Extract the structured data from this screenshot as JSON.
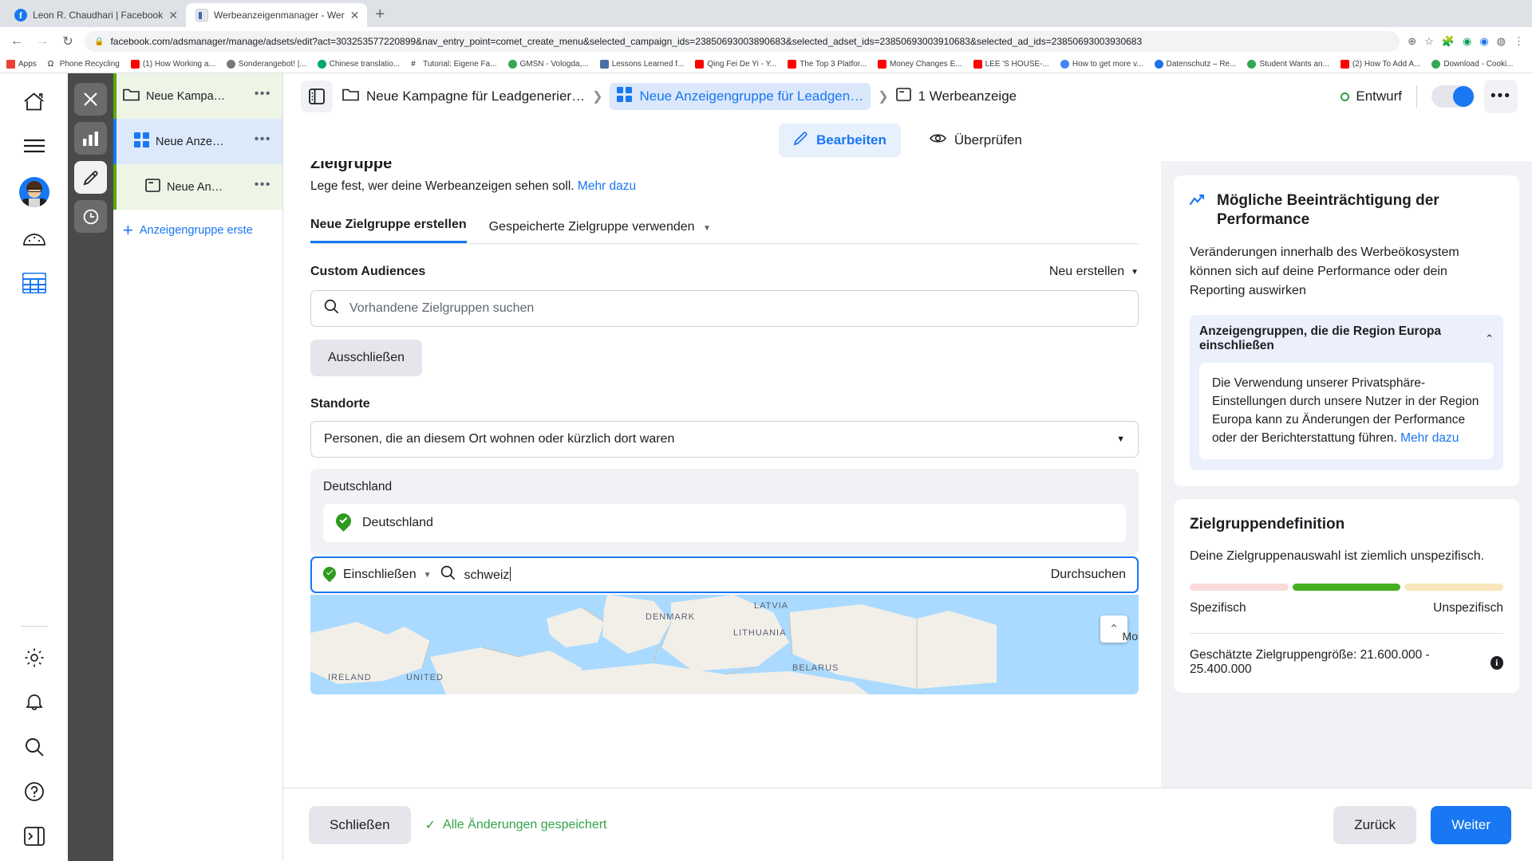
{
  "browser": {
    "tabs": [
      {
        "title": "Leon R. Chaudhari | Facebook",
        "favicon": "facebook-icon",
        "active": false
      },
      {
        "title": "Werbeanzeigenmanager - Wer",
        "favicon": "adsmanager-icon",
        "active": true
      }
    ],
    "new_tab_label": "+",
    "nav": {
      "back": "←",
      "forward": "→",
      "reload": "↻"
    },
    "url": "facebook.com/adsmanager/manage/adsets/edit?act=303253577220899&nav_entry_point=comet_create_menu&selected_campaign_ids=23850693003890683&selected_adset_ids=23850693003910683&selected_ad_ids=23850693003930683",
    "lock_icon": "lock-icon",
    "omni_icons": [
      "zoom-icon",
      "star-icon",
      "extension-puzzle-icon",
      "extension-green-icon",
      "extension-blue-icon",
      "profile-icon",
      "menu-icon"
    ],
    "bookmarks": [
      {
        "label": "Apps",
        "icon": "apps-grid-icon",
        "color": "#ea4335"
      },
      {
        "label": "Phone Recycling",
        "icon": "omega-icon",
        "color": "#202124"
      },
      {
        "label": "(1) How Working a...",
        "icon": "youtube-icon",
        "color": "#ff0000"
      },
      {
        "label": "Sonderangebot! |...",
        "icon": "globe-icon",
        "color": "#7a7a7a"
      },
      {
        "label": "Chinese translatio...",
        "icon": "leaf-icon",
        "color": "#00a86b"
      },
      {
        "label": "Tutorial: Eigene Fa...",
        "icon": "hash-icon",
        "color": "#202124"
      },
      {
        "label": "GMSN - Vologda,...",
        "icon": "circle-icon",
        "color": "#34a853"
      },
      {
        "label": "Lessons Learned f...",
        "icon": "er-icon",
        "color": "#4a6fa5"
      },
      {
        "label": "Qing Fei De Yi - Y...",
        "icon": "youtube-icon",
        "color": "#ff0000"
      },
      {
        "label": "The Top 3 Platfor...",
        "icon": "youtube-icon",
        "color": "#ff0000"
      },
      {
        "label": "Money Changes E...",
        "icon": "youtube-icon",
        "color": "#ff0000"
      },
      {
        "label": "LEE 'S HOUSE-...",
        "icon": "youtube-icon",
        "color": "#ff0000"
      },
      {
        "label": "How to get more v...",
        "icon": "globe-icon",
        "color": "#4285f4"
      },
      {
        "label": "Datenschutz – Re...",
        "icon": "globe-icon",
        "color": "#1a73e8"
      },
      {
        "label": "Student Wants an...",
        "icon": "globe-icon",
        "color": "#34a853"
      },
      {
        "label": "(2) How To Add A...",
        "icon": "youtube-icon",
        "color": "#ff0000"
      },
      {
        "label": "Download - Cooki...",
        "icon": "globe-icon",
        "color": "#34a853"
      }
    ]
  },
  "fb_rail": {
    "items": [
      {
        "name": "home-icon",
        "label": "Home"
      },
      {
        "name": "hamburger-menu-icon",
        "label": "Menü"
      },
      {
        "name": "avatar",
        "label": "Profil"
      },
      {
        "name": "gauge-icon",
        "label": "Übersicht"
      },
      {
        "name": "grid-table-icon",
        "label": "Tabelle"
      },
      {
        "name": "gear-icon",
        "label": "Einstellungen"
      },
      {
        "name": "bell-icon",
        "label": "Benachrichtigungen"
      },
      {
        "name": "search-icon",
        "label": "Suche"
      },
      {
        "name": "help-icon",
        "label": "Hilfe"
      },
      {
        "name": "collapse-panel-icon",
        "label": "Einklappen"
      }
    ]
  },
  "toolstrip": {
    "buttons": [
      {
        "name": "close-icon",
        "label": "Schließen",
        "active": false
      },
      {
        "name": "bar-chart-icon",
        "label": "Diagramm",
        "active": false
      },
      {
        "name": "pencil-edit-icon",
        "label": "Bearbeiten",
        "active": true
      },
      {
        "name": "clock-history-icon",
        "label": "Verlauf",
        "active": false
      }
    ]
  },
  "tree": {
    "rows": [
      {
        "label": "Neue Kampa…",
        "icon": "folder-icon",
        "type": "campaign",
        "menu": "•••"
      },
      {
        "label": "Neue Anze…",
        "icon": "adset-grid-icon",
        "type": "adset",
        "menu": "•••"
      },
      {
        "label": "Neue An…",
        "icon": "ad-window-icon",
        "type": "ad",
        "menu": "•••"
      }
    ],
    "add_label": "Anzeigengruppe erste",
    "add_icon": "plus-icon"
  },
  "workspace": {
    "panel_toggle_icon": "side-panel-icon",
    "breadcrumbs": [
      {
        "label": "Neue Kampagne für Leadgenerier…",
        "icon": "folder-icon",
        "selected": false
      },
      {
        "label": "Neue Anzeigengruppe für Leadgen…",
        "icon": "adset-grid-icon",
        "selected": true
      },
      {
        "label": "1 Werbeanzeige",
        "icon": "ad-window-icon",
        "selected": false
      }
    ],
    "status_label": "Entwurf",
    "status_color": "#31a24c",
    "toggle_on": true,
    "kebab_label": "•••",
    "tabs": [
      {
        "label": "Bearbeiten",
        "icon": "pencil-edit-icon",
        "active": true
      },
      {
        "label": "Überprüfen",
        "icon": "eye-icon",
        "active": false
      }
    ]
  },
  "form": {
    "section_title": "Zielgruppe",
    "section_sub": "Lege fest, wer deine Werbeanzeigen sehen soll.",
    "section_sub_link": "Mehr dazu",
    "audience_tabs": [
      {
        "label": "Neue Zielgruppe erstellen",
        "active": true,
        "caret": false
      },
      {
        "label": "Gespeicherte Zielgruppe verwenden",
        "active": false,
        "caret": true
      }
    ],
    "custom_audiences": {
      "heading": "Custom Audiences",
      "action": "Neu erstellen",
      "search_placeholder": "Vorhandene Zielgruppen suchen",
      "search_icon": "search-icon",
      "exclude_button": "Ausschließen"
    },
    "locations": {
      "heading": "Standorte",
      "selected_option": "Personen, die an diesem Ort wohnen oder kürzlich dort waren",
      "group_label": "Deutschland",
      "chips": [
        {
          "label": "Deutschland",
          "icon": "map-pin-check-icon"
        }
      ],
      "search": {
        "mode_label": "Einschließen",
        "mode_icon": "map-pin-check-icon",
        "search_icon": "search-icon",
        "value": "schweiz",
        "browse_label": "Durchsuchen"
      },
      "map": {
        "labels": [
          "DENMARK",
          "LATVIA",
          "LITHUANIA",
          "BELARUS",
          "IRELAND",
          "UNITED"
        ],
        "attribution": "Mos",
        "collapse_icon": "chevron-up-icon"
      }
    }
  },
  "side_info": {
    "performance_card": {
      "icon": "trend-line-icon",
      "title": "Mögliche Beeinträchtigung der Performance",
      "body": "Veränderungen innerhalb des Werbeökosystem können sich auf deine Performance oder dein Reporting auswirken",
      "callout": {
        "title": "Anzeigengruppen, die die Region Europa einschließen",
        "collapse_icon": "chevron-up-icon",
        "text": "Die Verwendung unserer Privatsphäre-Einstellungen durch unsere Nutzer in der Region Europa kann zu Änderungen der Performance oder der Berichterstattung führen.",
        "link": "Mehr dazu"
      }
    },
    "definition_card": {
      "title": "Zielgruppendefinition",
      "subtitle": "Deine Zielgruppenauswahl ist ziemlich unspezifisch.",
      "meter_left_label": "Spezifisch",
      "meter_right_label": "Unspezifisch",
      "meter_colors": [
        "#fbdada",
        "#45af20",
        "#fae6bc"
      ],
      "estimate_label": "Geschätzte Zielgruppengröße: 21.600.000 - 25.400.000",
      "info_icon": "info-icon"
    }
  },
  "footer": {
    "close_label": "Schließen",
    "saved_label": "Alle Änderungen gespeichert",
    "saved_icon": "check-icon",
    "back_label": "Zurück",
    "next_label": "Weiter"
  }
}
